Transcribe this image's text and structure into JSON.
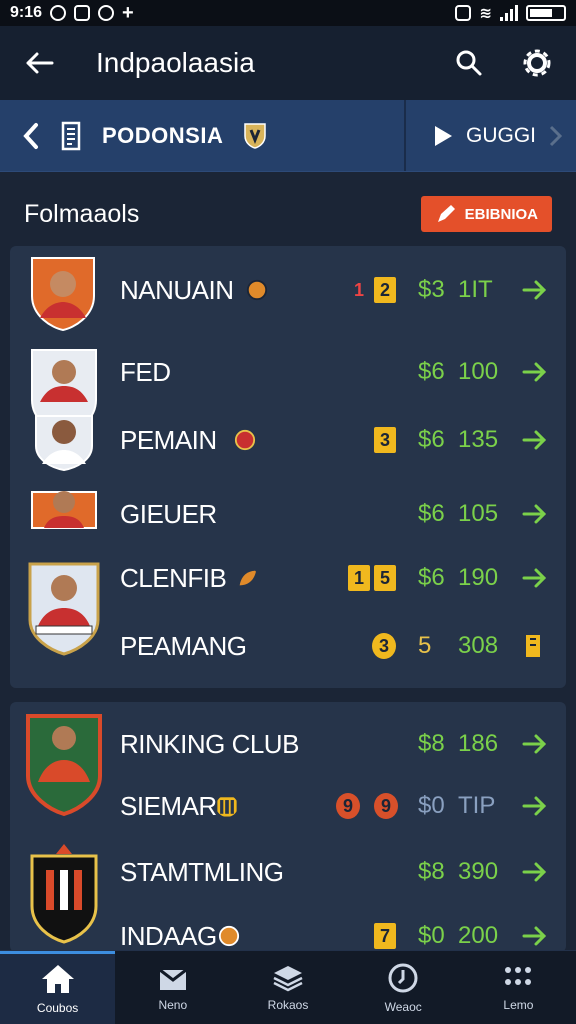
{
  "status_bar": {
    "time": "9:16"
  },
  "header": {
    "title": "Indpaolaasia"
  },
  "league_bar": {
    "left_label": "PODONSIA",
    "right_label": "GUGGI"
  },
  "section": {
    "title": "Folmaaols",
    "button_label": "EBIBNIOA"
  },
  "groups": [
    {
      "rows": [
        {
          "name": "NANUAIN",
          "badges": [
            "1",
            "2"
          ],
          "price": "$3",
          "value": "1IT"
        },
        {
          "name": "FED",
          "badges": [],
          "price": "$6",
          "value": "100"
        },
        {
          "name": "PEMAIN",
          "badges": [
            "3"
          ],
          "price": "$6",
          "value": "135"
        },
        {
          "name": "GIEUER",
          "badges": [],
          "price": "$6",
          "value": "105"
        },
        {
          "name": "CLENFIB",
          "badges": [
            "1",
            "5"
          ],
          "price": "$6",
          "value": "190"
        },
        {
          "name": "PEAMANG",
          "badges": [
            "3"
          ],
          "price": "5",
          "value": "308"
        }
      ]
    },
    {
      "rows": [
        {
          "name": "RINKING CLUB",
          "badges": [],
          "price": "$8",
          "value": "186"
        },
        {
          "name": "SIEMAR",
          "badges": [
            "9",
            "9"
          ],
          "price": "$0",
          "value": "TIP"
        },
        {
          "name": "STAMTMLING",
          "badges": [],
          "price": "$8",
          "value": "390"
        },
        {
          "name": "INDAAG",
          "badges": [
            "7"
          ],
          "price": "$0",
          "value": "200"
        }
      ]
    }
  ],
  "bottom_nav": [
    {
      "label": "Coubos"
    },
    {
      "label": "Neno"
    },
    {
      "label": "Rokaos"
    },
    {
      "label": "Weaoc"
    },
    {
      "label": "Lemo"
    }
  ],
  "colors": {
    "background": "#1b2536",
    "card": "#26344a",
    "league_bar": "#25406a",
    "accent_orange": "#e4502a",
    "accent_green": "#7bd14a",
    "badge_yellow": "#f0b81e"
  }
}
